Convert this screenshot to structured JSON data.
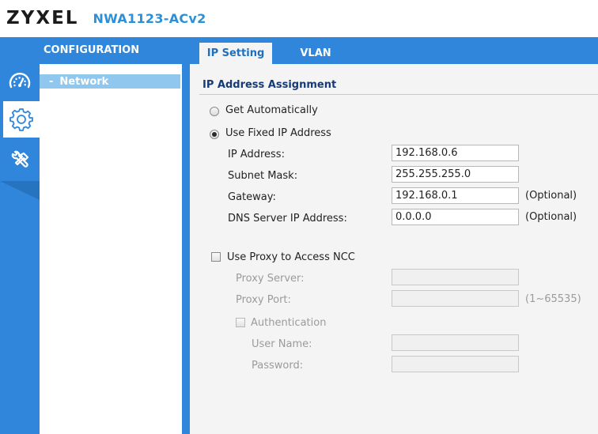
{
  "header": {
    "brand": "ZYXEL",
    "model": "NWA1123-ACv2"
  },
  "sidebar": {
    "section_label": "CONFIGURATION",
    "icons": [
      "dashboard-icon",
      "gear-icon",
      "maintenance-tools-icon"
    ],
    "items": [
      {
        "label": "Network",
        "bullet": "-"
      }
    ]
  },
  "tabs": [
    {
      "label": "IP Setting",
      "active": true
    },
    {
      "label": "VLAN",
      "active": false
    }
  ],
  "ip_assignment": {
    "title": "IP Address Assignment",
    "mode_auto_label": "Get Automatically",
    "mode_fixed_label": "Use Fixed IP Address",
    "selected_mode": "fixed",
    "fields": {
      "ip_label": "IP Address:",
      "ip_value": "192.168.0.6",
      "mask_label": "Subnet Mask:",
      "mask_value": "255.255.255.0",
      "gateway_label": "Gateway:",
      "gateway_value": "192.168.0.1",
      "gateway_hint": "(Optional)",
      "dns_label": "DNS Server IP Address:",
      "dns_value": "0.0.0.0",
      "dns_hint": "(Optional)"
    }
  },
  "proxy": {
    "enable_label": "Use Proxy to Access NCC",
    "enabled": false,
    "server_label": "Proxy Server:",
    "server_value": "",
    "port_label": "Proxy Port:",
    "port_value": "",
    "port_hint": "(1~65535)",
    "auth_label": "Authentication",
    "auth_enabled": false,
    "user_label": "User Name:",
    "user_value": "",
    "password_label": "Password:",
    "password_value": ""
  },
  "colors": {
    "accent": "#2f86db",
    "title": "#173a76",
    "brand_model": "#2d8fd6",
    "nav_selected": "#8fc7ee"
  }
}
